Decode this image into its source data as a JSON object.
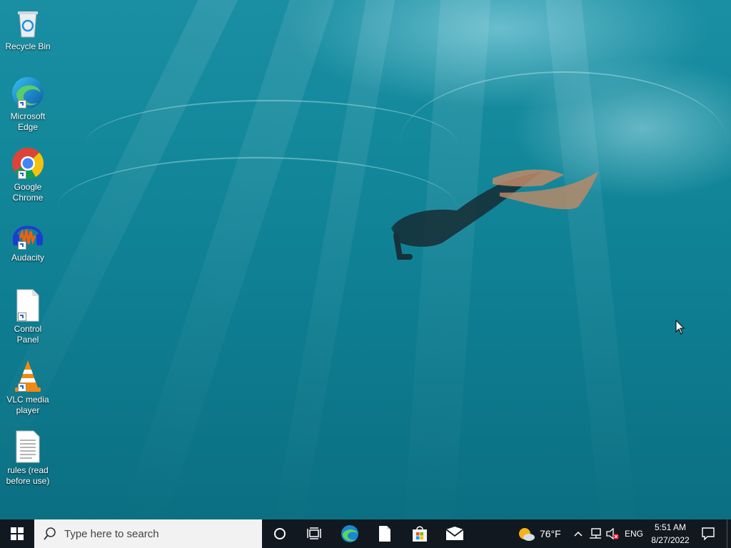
{
  "desktop": {
    "icons": [
      {
        "name": "recycle-bin",
        "label": "Recycle Bin"
      },
      {
        "name": "microsoft-edge",
        "label": "Microsoft Edge"
      },
      {
        "name": "google-chrome",
        "label": "Google Chrome"
      },
      {
        "name": "audacity",
        "label": "Audacity"
      },
      {
        "name": "control-panel",
        "label": "Control Panel"
      },
      {
        "name": "vlc-media-player",
        "label": "VLC media player"
      },
      {
        "name": "rules",
        "label": "rules (read before use)"
      }
    ]
  },
  "taskbar": {
    "search_placeholder": "Type here to search",
    "weather_temp": "76°F",
    "language": "ENG",
    "time": "5:51 AM",
    "date": "8/27/2022",
    "pinned": [
      "cortana-icon",
      "task-view-icon",
      "edge-icon",
      "file-icon",
      "store-icon",
      "mail-icon"
    ]
  },
  "colors": {
    "taskbar_bg": "#111820",
    "desktop_water": "#127f94",
    "search_bg": "#f2f2f2"
  }
}
